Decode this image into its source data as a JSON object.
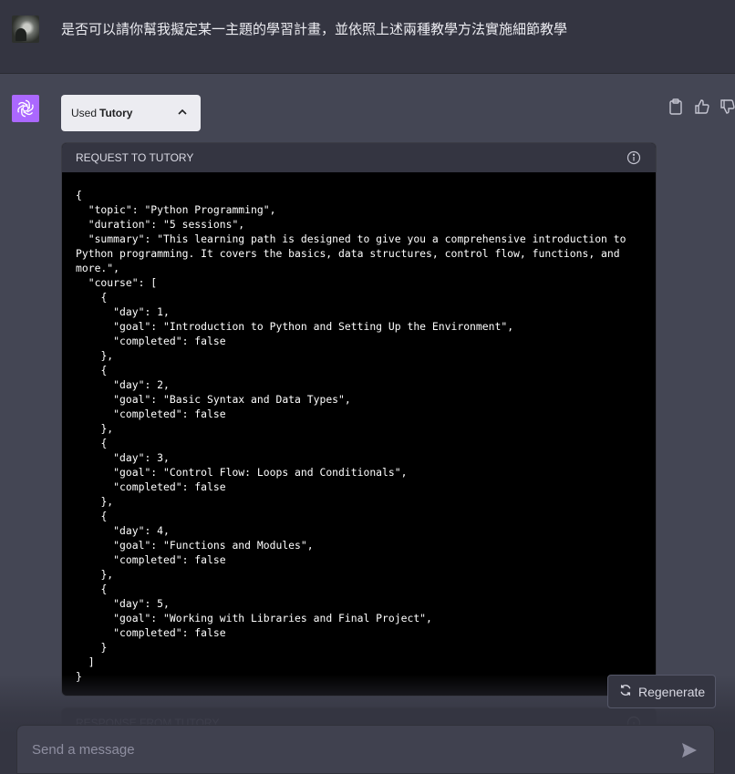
{
  "user": {
    "message": "是否可以請你幫我擬定某一主題的學習計畫，並依照上述兩種教學方法實施細節教學"
  },
  "assistant": {
    "used_prefix": "Used",
    "plugin_name": "Tutory",
    "request_title": "REQUEST TO TUTORY",
    "request_code": "{\n  \"topic\": \"Python Programming\",\n  \"duration\": \"5 sessions\",\n  \"summary\": \"This learning path is designed to give you a comprehensive introduction to Python programming. It covers the basics, data structures, control flow, functions, and more.\",\n  \"course\": [\n    {\n      \"day\": 1,\n      \"goal\": \"Introduction to Python and Setting Up the Environment\",\n      \"completed\": false\n    },\n    {\n      \"day\": 2,\n      \"goal\": \"Basic Syntax and Data Types\",\n      \"completed\": false\n    },\n    {\n      \"day\": 3,\n      \"goal\": \"Control Flow: Loops and Conditionals\",\n      \"completed\": false\n    },\n    {\n      \"day\": 4,\n      \"goal\": \"Functions and Modules\",\n      \"completed\": false\n    },\n    {\n      \"day\": 5,\n      \"goal\": \"Working with Libraries and Final Project\",\n      \"completed\": false\n    }\n  ]\n}",
    "response_title": "RESPONSE FROM TUTORY"
  },
  "controls": {
    "regenerate_label": "Regenerate",
    "composer_placeholder": "Send a message"
  },
  "icons": {
    "actions": [
      "clipboard-icon",
      "thumbs-up-icon",
      "thumbs-down-icon"
    ]
  },
  "colors": {
    "page_bg": "#444654",
    "header_bg": "#343541",
    "accent_avatar": "#ab68ff",
    "code_bg": "#000000"
  }
}
